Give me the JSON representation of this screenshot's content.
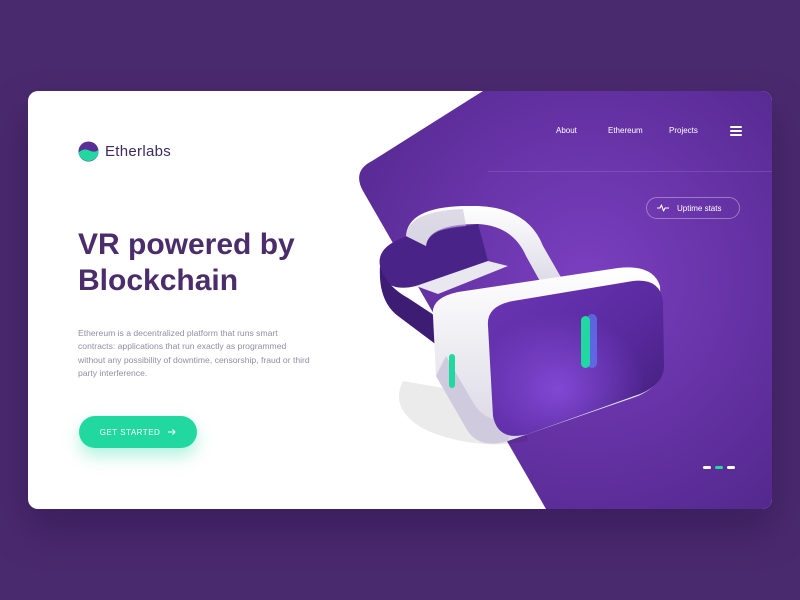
{
  "brand": {
    "name": "Etherlabs"
  },
  "nav": {
    "items": [
      {
        "label": "About"
      },
      {
        "label": "Ethereum"
      },
      {
        "label": "Projects"
      }
    ]
  },
  "uptime": {
    "label": "Uptime stats"
  },
  "hero": {
    "headline": "VR powered by Blockchain",
    "description": "Ethereum is a decentralized platform that runs smart contracts: applications that run exactly as programmed without any possibility of downtime, censorship, fraud or third party interference.",
    "cta_label": "GET STARTED"
  },
  "slider": {
    "count": 3,
    "active_index": 1
  },
  "colors": {
    "background": "#4a2a6e",
    "purple": "#5d2e9c",
    "accent": "#21d9a0",
    "headline": "#4a2d6a",
    "body_text": "#8f8ea6"
  },
  "icons": {
    "logo": "etherlabs-logo-icon",
    "menu": "hamburger-menu-icon",
    "uptime": "pulse-icon",
    "cta": "arrow-right-icon"
  }
}
